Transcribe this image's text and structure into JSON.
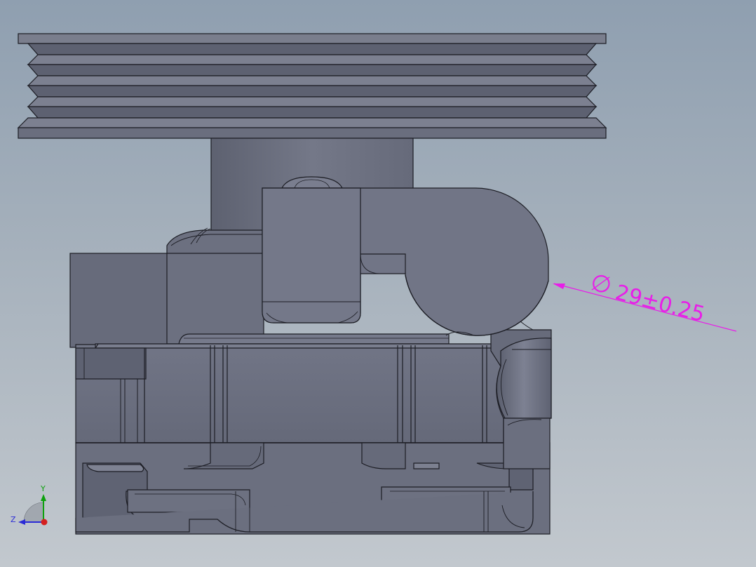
{
  "viewport": {
    "background_top": "#8f9fb0",
    "background_bottom": "#c2c8ce",
    "model_color": "#6f7384",
    "edge_color": "#1c1d24"
  },
  "annotation": {
    "diameter_symbol": "∅",
    "dimension_text": "29±0.25",
    "color": "#e81ee8"
  },
  "triad": {
    "y_label": "Y",
    "z_label": "Z"
  }
}
